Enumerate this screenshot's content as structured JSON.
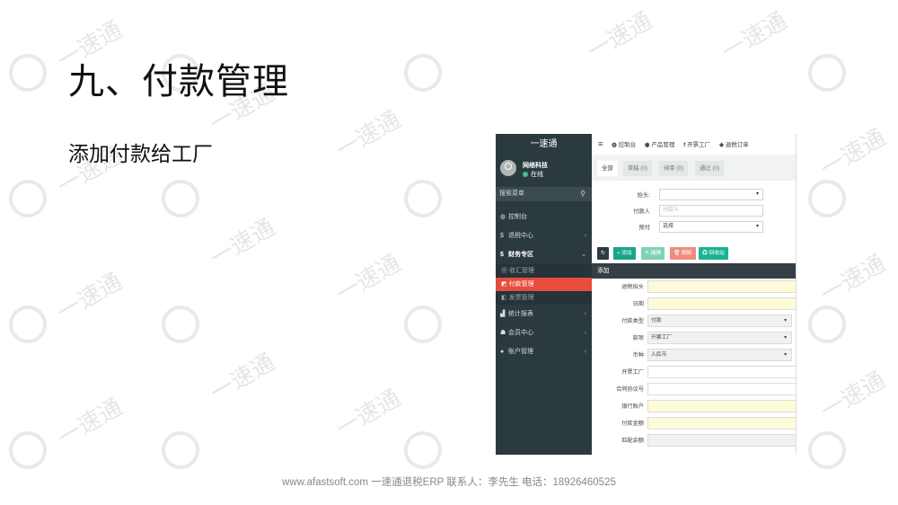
{
  "slide": {
    "title": "九、付款管理",
    "subtitle": "添加付款给工厂",
    "footer": "www.afastsoft.com 一速通退税ERP 联系人：李先生 电话：18926460525",
    "watermark": "一速通"
  },
  "sidebar": {
    "brand": "一速通",
    "user_name": "网络科技",
    "user_status": "在线",
    "search_placeholder": "搜索菜单",
    "items": [
      {
        "icon": "dashboard-icon",
        "glyph": "◍",
        "label": "控制台"
      },
      {
        "icon": "dollar-icon",
        "glyph": "$",
        "label": "退税中心",
        "arrow": "‹"
      },
      {
        "icon": "dollar-icon",
        "glyph": "$",
        "label": "财务专区",
        "arrow": "⌄"
      }
    ],
    "subitems": [
      {
        "icon": "bank-icon",
        "glyph": "▦",
        "label": "收汇管理"
      },
      {
        "icon": "payment-icon",
        "glyph": "◩",
        "label": "付款管理"
      },
      {
        "icon": "invoice-icon",
        "glyph": "◧",
        "label": "发票管理"
      }
    ],
    "items2": [
      {
        "icon": "chart-icon",
        "glyph": "▟",
        "label": "统计报表",
        "arrow": "‹"
      },
      {
        "icon": "users-icon",
        "glyph": "☗",
        "label": "会员中心",
        "arrow": "‹"
      },
      {
        "icon": "info-icon",
        "glyph": "●",
        "label": "账户管理",
        "arrow": "‹"
      }
    ]
  },
  "topnav": {
    "menu_glyph": "≡",
    "items": [
      "控制台",
      "产品管理",
      "开票工厂",
      "退税订单"
    ],
    "icons": [
      "◍",
      "◉",
      "f",
      "◈"
    ]
  },
  "tabs": [
    "全部",
    "草稿 (0)",
    "待审 (0)",
    "通过 (0)"
  ],
  "filters": {
    "header_label": "抬头:",
    "payee_label": "付款人",
    "payee_placeholder": "付款人",
    "prepay_label": "预付",
    "prepay_value": "选择"
  },
  "toolbar": {
    "refresh": "↻",
    "add": "+ 添加",
    "edit": "✎ 编辑",
    "delete": "🗑 删除",
    "recycle": "♻ 回收站",
    "colors": {
      "refresh": "#2d3c40",
      "add": "#18a689",
      "edit": "#7fd3b4",
      "delete": "#f08c7f",
      "recycle": "#1ab394"
    }
  },
  "dialog": {
    "title": "添加",
    "fields": [
      {
        "label": "退税抬头",
        "value": "",
        "style": "yellow"
      },
      {
        "label": "日期",
        "value": "",
        "style": "yellow"
      },
      {
        "label": "付款类型",
        "value": "付款",
        "style": "select"
      },
      {
        "label": "款项",
        "value": "开票工厂",
        "style": "select"
      },
      {
        "label": "币种",
        "value": "人民币",
        "style": "select"
      },
      {
        "label": "开票工厂",
        "value": "",
        "style": "plain"
      },
      {
        "label": "合同协议号",
        "value": "",
        "style": "plain"
      },
      {
        "label": "银行账户",
        "value": "",
        "style": "yellow"
      },
      {
        "label": "付款金额",
        "value": "",
        "style": "yellow"
      },
      {
        "label": "匹配余额",
        "value": "",
        "style": "grey"
      }
    ]
  }
}
